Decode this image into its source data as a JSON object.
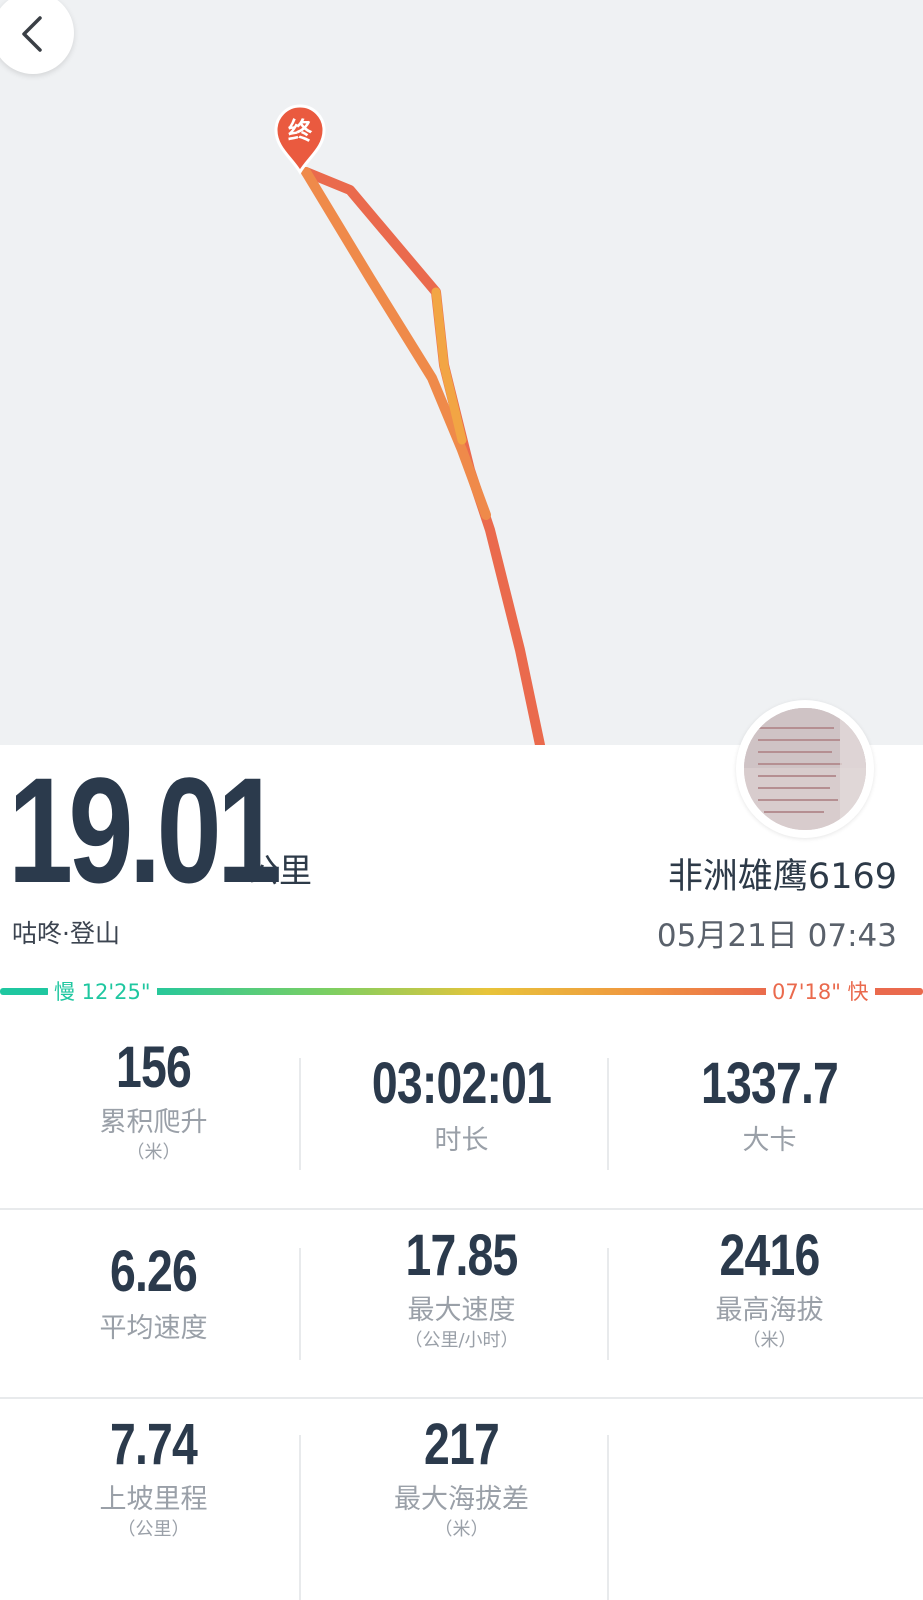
{
  "map": {
    "end_marker_label": "终",
    "route_colors": [
      "#ea6a4d",
      "#f0894a",
      "#f2a544"
    ]
  },
  "summary": {
    "distance_value": "19.01",
    "distance_unit": "公里",
    "activity_type": "咕咚·登山",
    "username": "非洲雄鹰6169",
    "datetime": "05月21日 07:43"
  },
  "pace_legend": {
    "slow_label": "慢 12'25\"",
    "fast_label": "07'18\" 快",
    "slow_color": "#1fc7a0",
    "fast_color": "#ea6a4d"
  },
  "stats": [
    {
      "value": "156",
      "label": "累积爬升",
      "unit": "（米）"
    },
    {
      "value": "03:02:01",
      "label": "时长",
      "unit": ""
    },
    {
      "value": "1337.7",
      "label": "大卡",
      "unit": ""
    },
    {
      "value": "6.26",
      "label": "平均速度",
      "unit": ""
    },
    {
      "value": "17.85",
      "label": "最大速度",
      "unit": "（公里/小时）"
    },
    {
      "value": "2416",
      "label": "最高海拔",
      "unit": "（米）"
    },
    {
      "value": "7.74",
      "label": "上坡里程",
      "unit": "（公里）"
    },
    {
      "value": "217",
      "label": "最大海拔差",
      "unit": "（米）"
    }
  ]
}
